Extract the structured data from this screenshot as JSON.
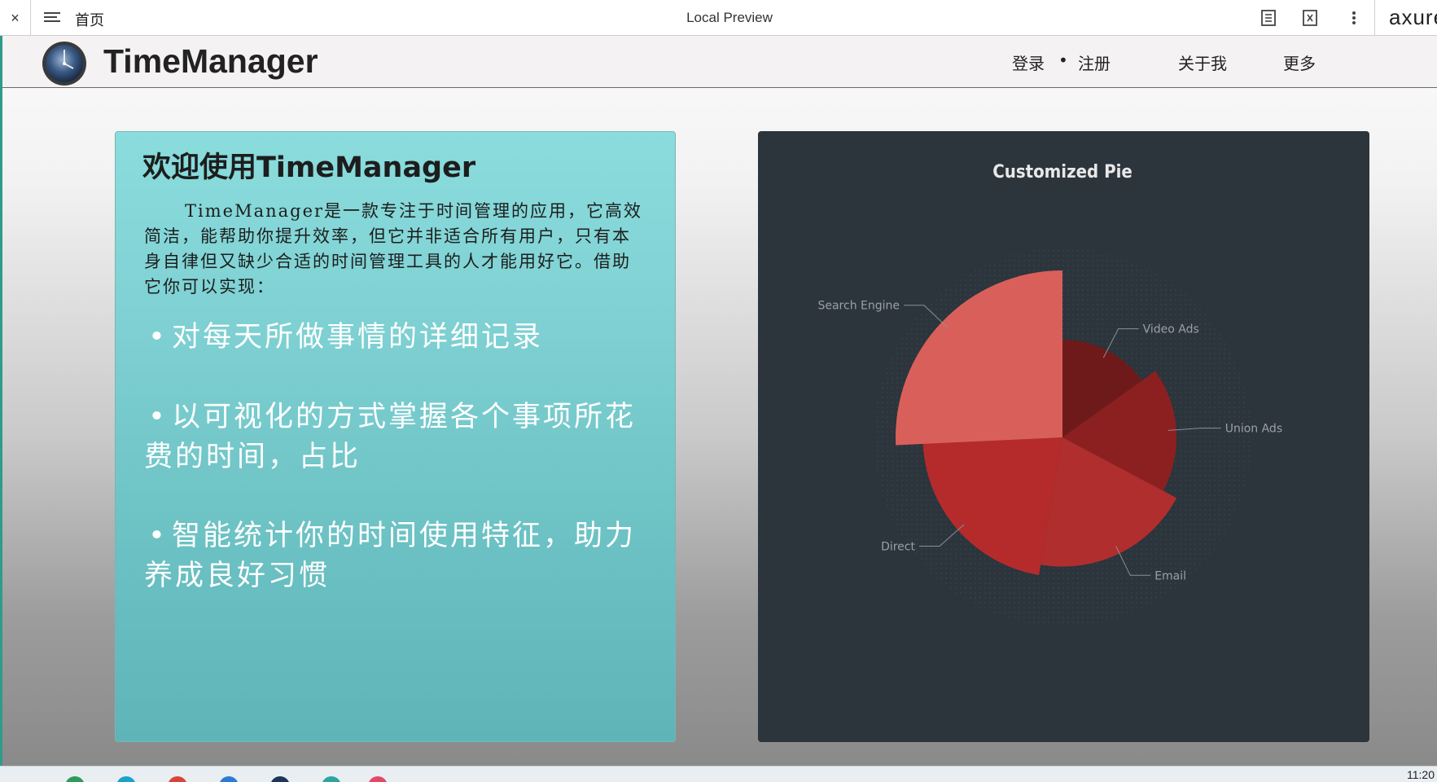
{
  "toolbar": {
    "close_label": "×",
    "page_name": "首页",
    "window_title": "Local Preview",
    "brand": "axure"
  },
  "header": {
    "app_name": "TimeManager",
    "nav": {
      "login": "登录",
      "separator": "•",
      "register": "注册",
      "about": "关于我",
      "more": "更多"
    }
  },
  "welcome": {
    "title": "欢迎使用TimeManager",
    "intro": "TimeManager是一款专注于时间管理的应用，它高效简洁，能帮助你提升效率，但它并非适合所有用户，只有本身自律但又缺少合适的时间管理工具的人才能用好它。借助它你可以实现：",
    "bullet": "•",
    "features": [
      "对每天所做事情的详细记录",
      "以可视化的方式掌握各个事项所花费的时间，占比",
      "智能统计你的时间使用特征，助力养成良好习惯"
    ]
  },
  "chart_data": {
    "type": "pie",
    "title": "Customized Pie",
    "variant": "nightingale-rose",
    "categories": [
      "Search Engine",
      "Direct",
      "Email",
      "Union Ads",
      "Video Ads"
    ],
    "values": [
      400,
      335,
      310,
      274,
      235
    ],
    "colors": [
      "#d9605a",
      "#b52b2b",
      "#b02e2e",
      "#8c2020",
      "#6f1a1a"
    ],
    "legend": "none",
    "background": "#2c343c"
  },
  "taskbar": {
    "clock": "11:20"
  }
}
